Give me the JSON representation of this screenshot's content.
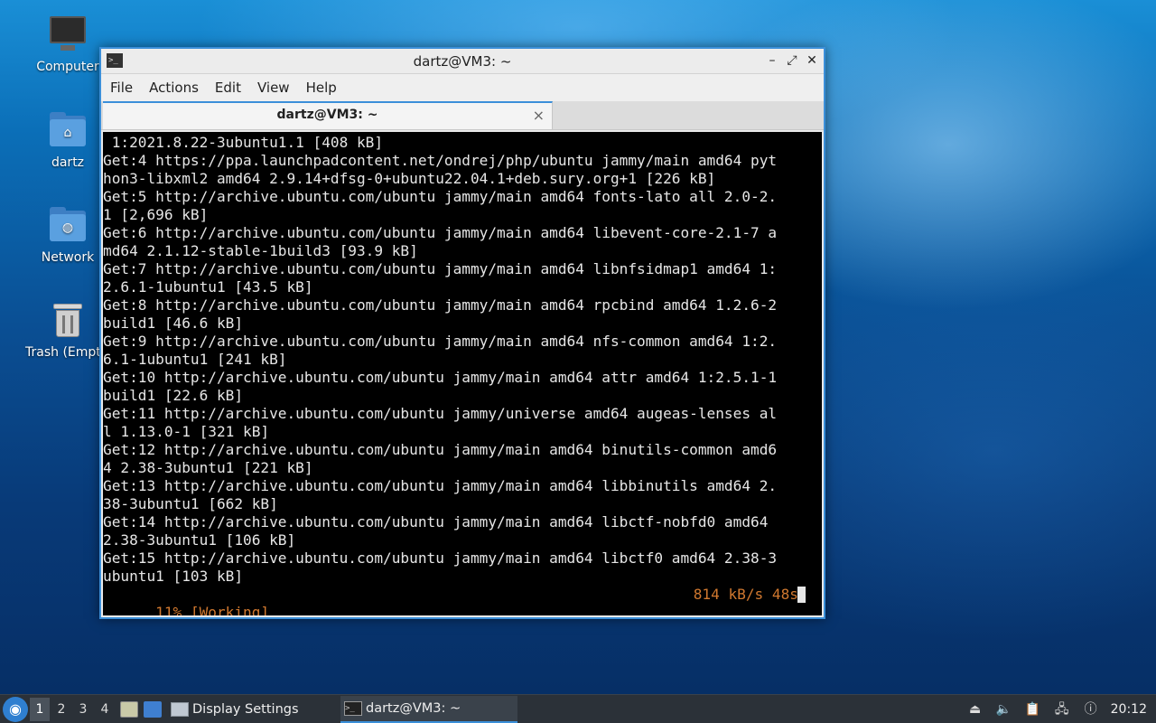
{
  "desktop": {
    "icons": [
      {
        "label": "Computer",
        "icon": "computer-icon"
      },
      {
        "label": "dartz",
        "icon": "home-folder-icon"
      },
      {
        "label": "Network",
        "icon": "network-folder-icon"
      },
      {
        "label": "Trash (Empty)",
        "icon": "trash-icon"
      }
    ]
  },
  "window": {
    "title": "dartz@VM3: ~",
    "menu": [
      "File",
      "Actions",
      "Edit",
      "View",
      "Help"
    ],
    "tab_label": "dartz@VM3: ~",
    "close_glyph": "×",
    "terminal_lines": [
      " 1:2021.8.22-3ubuntu1.1 [408 kB]",
      "Get:4 https://ppa.launchpadcontent.net/ondrej/php/ubuntu jammy/main amd64 pyt",
      "hon3-libxml2 amd64 2.9.14+dfsg-0+ubuntu22.04.1+deb.sury.org+1 [226 kB]",
      "Get:5 http://archive.ubuntu.com/ubuntu jammy/main amd64 fonts-lato all 2.0-2.",
      "1 [2,696 kB]",
      "Get:6 http://archive.ubuntu.com/ubuntu jammy/main amd64 libevent-core-2.1-7 a",
      "md64 2.1.12-stable-1build3 [93.9 kB]",
      "Get:7 http://archive.ubuntu.com/ubuntu jammy/main amd64 libnfsidmap1 amd64 1:",
      "2.6.1-1ubuntu1 [43.5 kB]",
      "Get:8 http://archive.ubuntu.com/ubuntu jammy/main amd64 rpcbind amd64 1.2.6-2",
      "build1 [46.6 kB]",
      "Get:9 http://archive.ubuntu.com/ubuntu jammy/main amd64 nfs-common amd64 1:2.",
      "6.1-1ubuntu1 [241 kB]",
      "Get:10 http://archive.ubuntu.com/ubuntu jammy/main amd64 attr amd64 1:2.5.1-1",
      "build1 [22.6 kB]",
      "Get:11 http://archive.ubuntu.com/ubuntu jammy/universe amd64 augeas-lenses al",
      "l 1.13.0-1 [321 kB]",
      "Get:12 http://archive.ubuntu.com/ubuntu jammy/main amd64 binutils-common amd6",
      "4 2.38-3ubuntu1 [221 kB]",
      "Get:13 http://archive.ubuntu.com/ubuntu jammy/main amd64 libbinutils amd64 2.",
      "38-3ubuntu1 [662 kB]",
      "Get:14 http://archive.ubuntu.com/ubuntu jammy/main amd64 libctf-nobfd0 amd64",
      "2.38-3ubuntu1 [106 kB]",
      "Get:15 http://archive.ubuntu.com/ubuntu jammy/main amd64 libctf0 amd64 2.38-3",
      "ubuntu1 [103 kB]"
    ],
    "status_left": "11% [Working]",
    "status_right": "814 kB/s 48s",
    "status_color": "#d0782f"
  },
  "taskbar": {
    "workspaces": [
      "1",
      "2",
      "3",
      "4"
    ],
    "active_workspace": "1",
    "tasks": [
      {
        "label": "Display Settings",
        "icon": "display-settings-icon"
      },
      {
        "label": "dartz@VM3: ~",
        "icon": "terminal-icon"
      }
    ],
    "clock": "20:12"
  }
}
